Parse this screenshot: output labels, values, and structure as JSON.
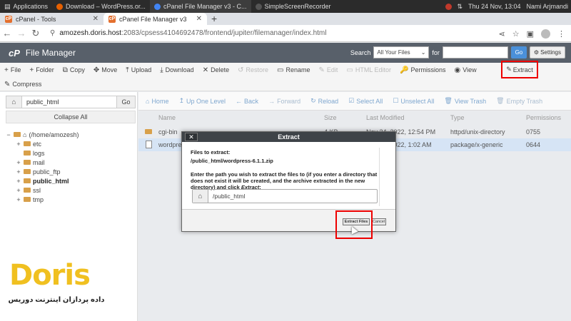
{
  "os": {
    "applications": "Applications",
    "tasks": [
      {
        "label": "Download – WordPress.or...",
        "color": "#e66000"
      },
      {
        "label": "cPanel File Manager v3 - C...",
        "color": "#4285f4"
      },
      {
        "label": "SimpleScreenRecorder",
        "color": "#555555"
      }
    ],
    "clock": "Thu 24 Nov, 13:04",
    "user": "Nami Arjmandi"
  },
  "browser": {
    "tabs": [
      {
        "label": "cPanel - Tools",
        "favicon": "cP"
      },
      {
        "label": "cPanel File Manager v3",
        "favicon": "cP"
      }
    ],
    "newtab": "+",
    "url_host": "amozesh.doris.host",
    "url_rest": ":2083/cpsess4104692478/frontend/jupiter/filemanager/index.html"
  },
  "header": {
    "logo": "cP",
    "title": "File Manager",
    "search_label": "Search",
    "search_scope": "All Your Files",
    "for_label": "for",
    "go": "Go",
    "settings": "Settings"
  },
  "toolbar": {
    "row1": [
      {
        "icon": "+",
        "label": "File",
        "disabled": false
      },
      {
        "icon": "+",
        "label": "Folder",
        "disabled": false
      },
      {
        "icon": "⧉",
        "label": "Copy",
        "disabled": false
      },
      {
        "icon": "✥",
        "label": "Move",
        "disabled": false
      },
      {
        "icon": "⤒",
        "label": "Upload",
        "disabled": false
      },
      {
        "icon": "⤓",
        "label": "Download",
        "disabled": false
      },
      {
        "icon": "✕",
        "label": "Delete",
        "disabled": false
      },
      {
        "icon": "↺",
        "label": "Restore",
        "disabled": true
      },
      {
        "icon": "▭",
        "label": "Rename",
        "disabled": false
      },
      {
        "icon": "✎",
        "label": "Edit",
        "disabled": true
      },
      {
        "icon": "▭",
        "label": "HTML Editor",
        "disabled": true
      },
      {
        "icon": "🔑",
        "label": "Permissions",
        "disabled": false
      },
      {
        "icon": "◉",
        "label": "View",
        "disabled": false
      }
    ],
    "extract": "Extract",
    "compress": "Compress"
  },
  "sidebar": {
    "path": "public_html",
    "go": "Go",
    "collapse": "Collapse All",
    "root": "(/home/amozesh)",
    "items": [
      {
        "label": "etc",
        "toggle": "+",
        "bold": false
      },
      {
        "label": "logs",
        "toggle": "",
        "bold": false
      },
      {
        "label": "mail",
        "toggle": "+",
        "bold": false
      },
      {
        "label": "public_ftp",
        "toggle": "+",
        "bold": false
      },
      {
        "label": "public_html",
        "toggle": "+",
        "bold": true
      },
      {
        "label": "ssl",
        "toggle": "+",
        "bold": false
      },
      {
        "label": "tmp",
        "toggle": "+",
        "bold": false
      }
    ]
  },
  "main": {
    "actions": [
      {
        "icon": "⌂",
        "label": "Home",
        "disabled": false
      },
      {
        "icon": "↥",
        "label": "Up One Level",
        "disabled": false
      },
      {
        "icon": "←",
        "label": "Back",
        "disabled": false
      },
      {
        "icon": "→",
        "label": "Forward",
        "disabled": true
      },
      {
        "icon": "↻",
        "label": "Reload",
        "disabled": false
      },
      {
        "icon": "☑",
        "label": "Select All",
        "disabled": false
      },
      {
        "icon": "☐",
        "label": "Unselect All",
        "disabled": false
      },
      {
        "icon": "🗑",
        "label": "View Trash",
        "disabled": false
      },
      {
        "icon": "🗑",
        "label": "Empty Trash",
        "disabled": true
      }
    ],
    "columns": {
      "name": "Name",
      "size": "Size",
      "modified": "Last Modified",
      "type": "Type",
      "perms": "Permissions"
    },
    "files": [
      {
        "name": "cgi-bin",
        "size": "4 KB",
        "modified": "Nov 24, 2022, 12:54 PM",
        "type": "httpd/unix-directory",
        "perms": "0755",
        "kind": "folder"
      },
      {
        "name": "wordpress-6.1.1.zip",
        "size": "",
        "modified": "Nov 24, 2022, 1:02 AM",
        "type": "package/x-generic",
        "perms": "0644",
        "kind": "file"
      }
    ]
  },
  "dialog": {
    "title": "Extract",
    "close": "✕",
    "files_label": "Files to extract:",
    "file_path": "/public_html/wordpress-6.1.1.zip",
    "instruction": "Enter the path you wish to extract the files to (if you enter a directory that does not exist it will be created, and the archive extracted in the new directory) and click ",
    "instruction_em": "Extract",
    "instruction_end": ":",
    "path_value": "/public_html",
    "extract_btn": "Extract Files",
    "cancel_btn": "Cancel"
  },
  "brand": {
    "word": "Doris",
    "tagline": "داده پردازان اینترنت دوریس"
  }
}
